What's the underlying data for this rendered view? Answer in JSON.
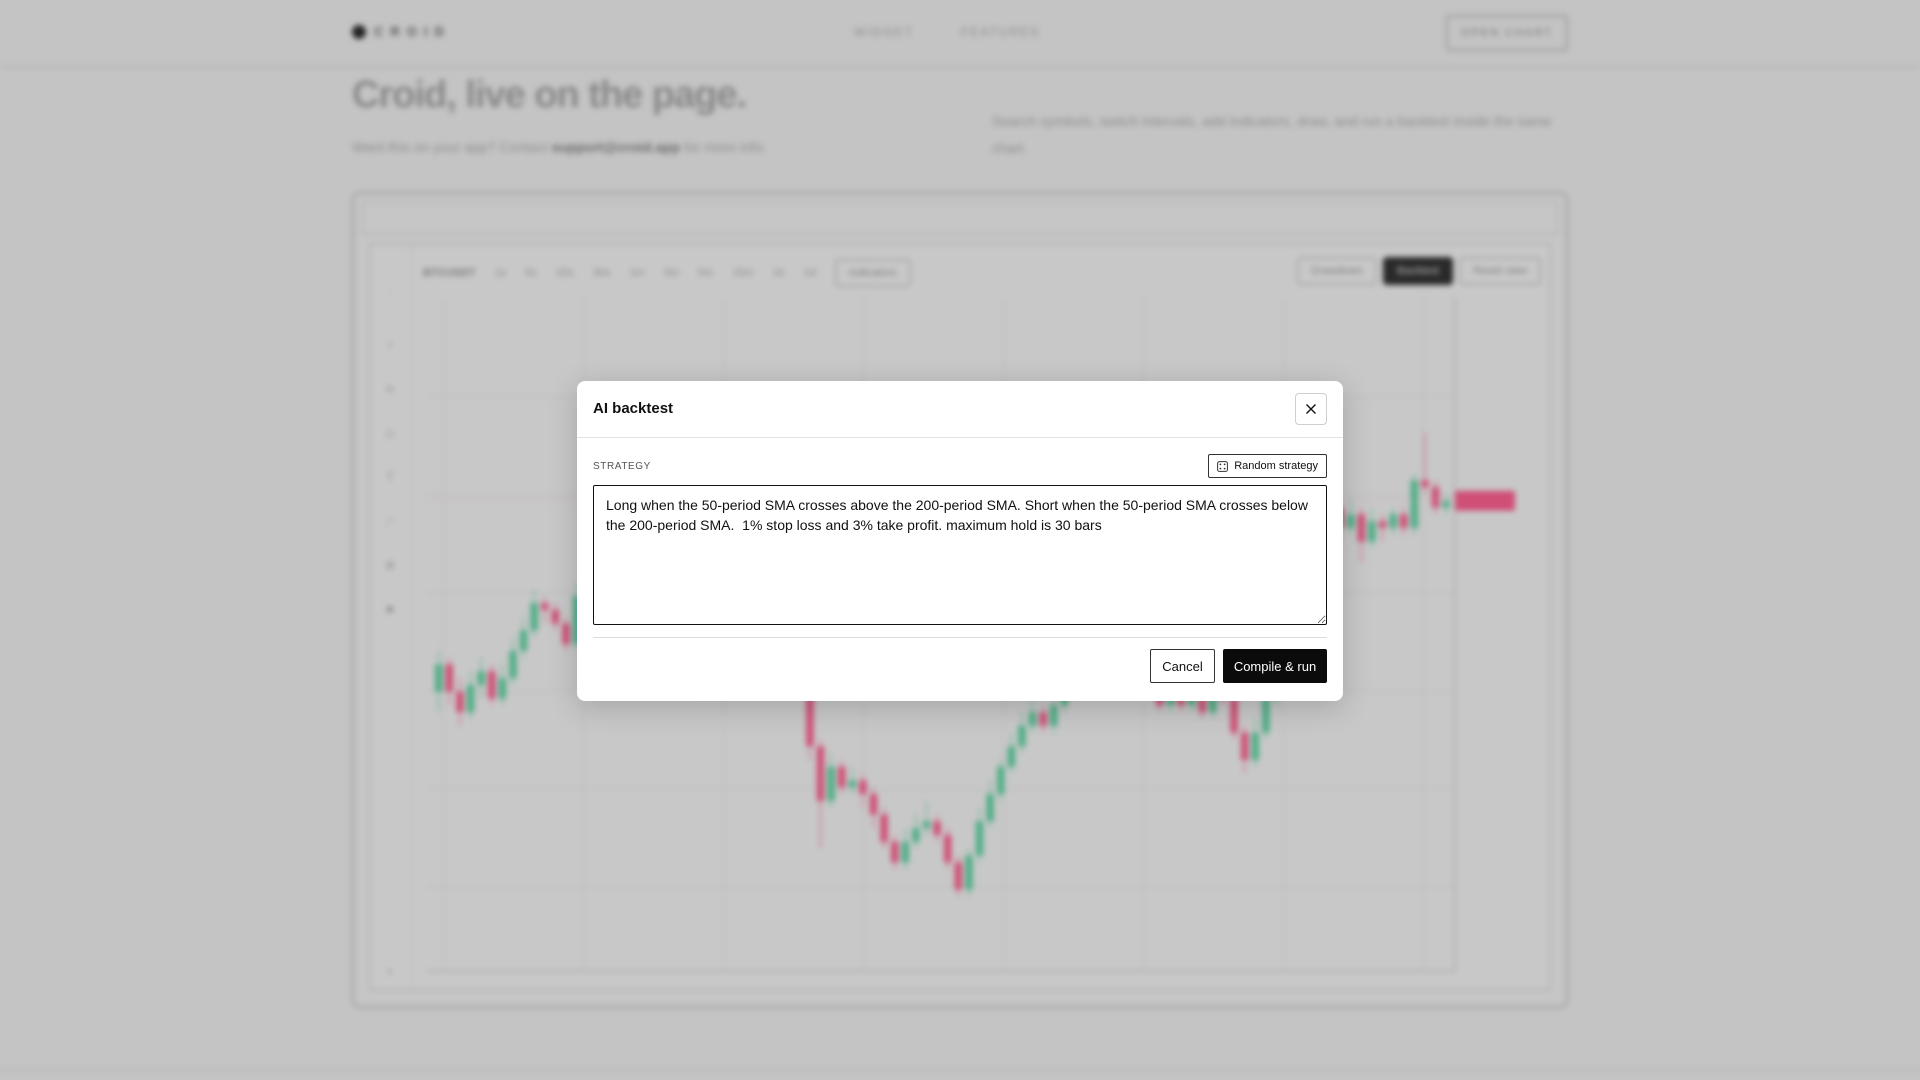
{
  "nav": {
    "brand": "CROID",
    "links": [
      "WIDGET",
      "FEATURES"
    ],
    "cta": "OPEN CHART"
  },
  "hero": {
    "title": "Croid, live on the page.",
    "sub_prefix": "Want this on your app? Contact",
    "sub_email": "support@croid.app",
    "sub_suffix": "for more info.",
    "description": "Search symbols, switch intervals, add indicators, draw, and run a backtest inside the same chart."
  },
  "chart_toolbar": {
    "symbol": "BTCUSDT",
    "intervals": [
      "1s",
      "5s",
      "15s",
      "30s",
      "1m",
      "3m",
      "5m",
      "15m",
      "1h",
      "1d"
    ],
    "indicators_label": "Indicators",
    "right_buttons": [
      "Drawdown",
      "Backtest",
      "Reset view"
    ]
  },
  "chart_data": {
    "type": "candlestick",
    "title": "",
    "x_ticks": [
      "",
      "",
      "",
      "",
      "",
      "",
      "",
      ""
    ],
    "y_ticks": [
      "",
      "",
      "",
      "",
      "",
      ""
    ],
    "candles": [
      {
        "o": 58,
        "c": 62,
        "h": 64,
        "l": 55
      },
      {
        "o": 62,
        "c": 58,
        "h": 63,
        "l": 56
      },
      {
        "o": 58,
        "c": 55,
        "h": 60,
        "l": 53
      },
      {
        "o": 55,
        "c": 59,
        "h": 61,
        "l": 54
      },
      {
        "o": 59,
        "c": 61,
        "h": 63,
        "l": 57
      },
      {
        "o": 61,
        "c": 57,
        "h": 62,
        "l": 56
      },
      {
        "o": 57,
        "c": 60,
        "h": 62,
        "l": 56
      },
      {
        "o": 60,
        "c": 64,
        "h": 66,
        "l": 59
      },
      {
        "o": 64,
        "c": 67,
        "h": 69,
        "l": 63
      },
      {
        "o": 67,
        "c": 71,
        "h": 73,
        "l": 66
      },
      {
        "o": 71,
        "c": 70,
        "h": 72,
        "l": 68
      },
      {
        "o": 70,
        "c": 68,
        "h": 71,
        "l": 67
      },
      {
        "o": 68,
        "c": 65,
        "h": 69,
        "l": 64
      },
      {
        "o": 65,
        "c": 72,
        "h": 74,
        "l": 64
      },
      {
        "o": 72,
        "c": 79,
        "h": 80,
        "l": 71
      },
      {
        "o": 79,
        "c": 78,
        "h": 81,
        "l": 76
      },
      {
        "o": 78,
        "c": 82,
        "h": 84,
        "l": 77
      },
      {
        "o": 82,
        "c": 86,
        "h": 88,
        "l": 81
      },
      {
        "o": 86,
        "c": 84,
        "h": 87,
        "l": 82
      },
      {
        "o": 84,
        "c": 80,
        "h": 85,
        "l": 79
      },
      {
        "o": 80,
        "c": 76,
        "h": 81,
        "l": 75
      },
      {
        "o": 76,
        "c": 72,
        "h": 77,
        "l": 70
      },
      {
        "o": 72,
        "c": 70,
        "h": 73,
        "l": 68
      },
      {
        "o": 70,
        "c": 66,
        "h": 71,
        "l": 65
      },
      {
        "o": 66,
        "c": 62,
        "h": 67,
        "l": 61
      },
      {
        "o": 62,
        "c": 58,
        "h": 63,
        "l": 57
      },
      {
        "o": 58,
        "c": 60,
        "h": 62,
        "l": 57
      },
      {
        "o": 60,
        "c": 64,
        "h": 66,
        "l": 59
      },
      {
        "o": 64,
        "c": 68,
        "h": 70,
        "l": 63
      },
      {
        "o": 68,
        "c": 66,
        "h": 69,
        "l": 64
      },
      {
        "o": 66,
        "c": 70,
        "h": 72,
        "l": 65
      },
      {
        "o": 70,
        "c": 74,
        "h": 76,
        "l": 69
      },
      {
        "o": 74,
        "c": 72,
        "h": 75,
        "l": 70
      },
      {
        "o": 72,
        "c": 68,
        "h": 73,
        "l": 67
      },
      {
        "o": 68,
        "c": 62,
        "h": 69,
        "l": 61
      },
      {
        "o": 62,
        "c": 50,
        "h": 63,
        "l": 48
      },
      {
        "o": 50,
        "c": 42,
        "h": 51,
        "l": 35
      },
      {
        "o": 42,
        "c": 47,
        "h": 49,
        "l": 41
      },
      {
        "o": 47,
        "c": 44,
        "h": 48,
        "l": 43
      },
      {
        "o": 44,
        "c": 45,
        "h": 47,
        "l": 43
      },
      {
        "o": 45,
        "c": 43,
        "h": 46,
        "l": 41
      },
      {
        "o": 43,
        "c": 40,
        "h": 44,
        "l": 38
      },
      {
        "o": 40,
        "c": 36,
        "h": 41,
        "l": 35
      },
      {
        "o": 36,
        "c": 33,
        "h": 37,
        "l": 32
      },
      {
        "o": 33,
        "c": 36,
        "h": 38,
        "l": 32
      },
      {
        "o": 36,
        "c": 38,
        "h": 40,
        "l": 35
      },
      {
        "o": 38,
        "c": 39,
        "h": 42,
        "l": 37
      },
      {
        "o": 39,
        "c": 37,
        "h": 40,
        "l": 36
      },
      {
        "o": 37,
        "c": 33,
        "h": 38,
        "l": 32
      },
      {
        "o": 33,
        "c": 29,
        "h": 34,
        "l": 28
      },
      {
        "o": 29,
        "c": 34,
        "h": 35,
        "l": 28
      },
      {
        "o": 34,
        "c": 39,
        "h": 41,
        "l": 33
      },
      {
        "o": 39,
        "c": 43,
        "h": 45,
        "l": 38
      },
      {
        "o": 43,
        "c": 47,
        "h": 48,
        "l": 42
      },
      {
        "o": 47,
        "c": 50,
        "h": 52,
        "l": 46
      },
      {
        "o": 50,
        "c": 53,
        "h": 55,
        "l": 49
      },
      {
        "o": 53,
        "c": 55,
        "h": 57,
        "l": 52
      },
      {
        "o": 55,
        "c": 53,
        "h": 56,
        "l": 52
      },
      {
        "o": 53,
        "c": 56,
        "h": 58,
        "l": 52
      },
      {
        "o": 56,
        "c": 58,
        "h": 60,
        "l": 55
      },
      {
        "o": 58,
        "c": 60,
        "h": 62,
        "l": 57
      },
      {
        "o": 60,
        "c": 62,
        "h": 64,
        "l": 59
      },
      {
        "o": 62,
        "c": 63,
        "h": 65,
        "l": 61
      },
      {
        "o": 63,
        "c": 65,
        "h": 66,
        "l": 62
      },
      {
        "o": 65,
        "c": 63,
        "h": 66,
        "l": 62
      },
      {
        "o": 63,
        "c": 66,
        "h": 67,
        "l": 62
      },
      {
        "o": 66,
        "c": 64,
        "h": 67,
        "l": 63
      },
      {
        "o": 64,
        "c": 60,
        "h": 65,
        "l": 58
      },
      {
        "o": 60,
        "c": 56,
        "h": 61,
        "l": 55
      },
      {
        "o": 56,
        "c": 59,
        "h": 60,
        "l": 55
      },
      {
        "o": 59,
        "c": 56,
        "h": 60,
        "l": 55
      },
      {
        "o": 56,
        "c": 60,
        "h": 62,
        "l": 55
      },
      {
        "o": 60,
        "c": 55,
        "h": 61,
        "l": 54
      },
      {
        "o": 55,
        "c": 60,
        "h": 61,
        "l": 54
      },
      {
        "o": 60,
        "c": 57,
        "h": 61,
        "l": 56
      },
      {
        "o": 57,
        "c": 52,
        "h": 58,
        "l": 51
      },
      {
        "o": 52,
        "c": 48,
        "h": 53,
        "l": 46
      },
      {
        "o": 48,
        "c": 52,
        "h": 54,
        "l": 47
      },
      {
        "o": 52,
        "c": 57,
        "h": 59,
        "l": 51
      },
      {
        "o": 57,
        "c": 62,
        "h": 64,
        "l": 56
      },
      {
        "o": 62,
        "c": 67,
        "h": 70,
        "l": 61
      },
      {
        "o": 67,
        "c": 78,
        "h": 80,
        "l": 66
      },
      {
        "o": 78,
        "c": 84,
        "h": 86,
        "l": 77
      },
      {
        "o": 84,
        "c": 90,
        "h": 92,
        "l": 83
      },
      {
        "o": 90,
        "c": 85,
        "h": 91,
        "l": 84
      },
      {
        "o": 85,
        "c": 82,
        "h": 86,
        "l": 80
      },
      {
        "o": 82,
        "c": 84,
        "h": 86,
        "l": 81
      },
      {
        "o": 84,
        "c": 80,
        "h": 85,
        "l": 77
      },
      {
        "o": 80,
        "c": 83,
        "h": 85,
        "l": 79
      },
      {
        "o": 83,
        "c": 82,
        "h": 84,
        "l": 80
      },
      {
        "o": 82,
        "c": 84,
        "h": 85,
        "l": 81
      },
      {
        "o": 84,
        "c": 82,
        "h": 85,
        "l": 81
      },
      {
        "o": 82,
        "c": 89,
        "h": 90,
        "l": 81
      },
      {
        "o": 89,
        "c": 88,
        "h": 96,
        "l": 87
      },
      {
        "o": 88,
        "c": 85,
        "h": 89,
        "l": 84
      },
      {
        "o": 85,
        "c": 86,
        "h": 87,
        "l": 84
      }
    ]
  },
  "modal": {
    "title": "AI backtest",
    "strategy_label": "STRATEGY",
    "random_button": "Random strategy",
    "strategy_text": "Long when the 50-period SMA crosses above the 200-period SMA. Short when the 50-period SMA crosses below the 200-period SMA.  1% stop loss and 3% take profit. maximum hold is 30 bars",
    "cancel": "Cancel",
    "compile_run": "Compile & run"
  },
  "colors": {
    "accent_dark": "#0b0b0b",
    "candle_up": "#4fae86",
    "candle_down": "#cf4f76"
  }
}
